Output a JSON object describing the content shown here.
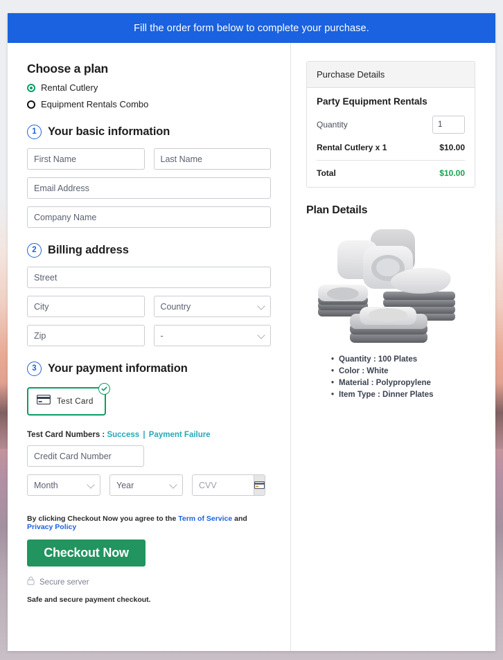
{
  "banner": {
    "message": "Fill the order form below to complete your purchase."
  },
  "plan": {
    "heading": "Choose a plan",
    "options": [
      {
        "label": "Rental Cutlery",
        "selected": true
      },
      {
        "label": "Equipment Rentals Combo",
        "selected": false
      }
    ]
  },
  "steps": {
    "basic": {
      "number": "1",
      "title": "Your basic information",
      "fields": {
        "first_name": "First Name",
        "last_name": "Last Name",
        "email": "Email Address",
        "company": "Company Name"
      }
    },
    "billing": {
      "number": "2",
      "title": "Billing address",
      "fields": {
        "street": "Street",
        "city": "City",
        "country": "Country",
        "zip": "Zip",
        "state": "-"
      }
    },
    "payment": {
      "number": "3",
      "title": "Your payment information",
      "method_label": "Test Card",
      "method_selected": true,
      "test_cards_prefix": "Test Card Numbers :",
      "test_card_success": "Success",
      "test_card_separator": "|",
      "test_card_failure": "Payment Failure",
      "fields": {
        "card_number": "Credit Card Number",
        "month": "Month",
        "year": "Year",
        "cvv": "CVV"
      }
    }
  },
  "footer": {
    "terms_prefix": "By clicking Checkout Now you agree to the",
    "terms_link": "Term of Service",
    "terms_and": "and",
    "privacy_link": "Privacy Policy",
    "checkout_label": "Checkout Now",
    "secure_server": "Secure server",
    "safe_note": "Safe and secure payment checkout."
  },
  "purchase": {
    "header": "Purchase Details",
    "product": "Party Equipment Rentals",
    "quantity_label": "Quantity",
    "quantity_value": "1",
    "line_item_label": "Rental Cutlery x 1",
    "line_item_amount": "$10.00",
    "total_label": "Total",
    "total_amount": "$10.00"
  },
  "plan_details": {
    "title": "Plan Details",
    "image_alt": "white square dinner plates and bowls stack",
    "specs": [
      "Quantity : 100 Plates",
      "Color : White",
      "Material : Polypropylene",
      "Item Type : Dinner Plates"
    ]
  },
  "colors": {
    "banner_blue": "#1a62df",
    "accent_green": "#0a9d62",
    "checkout_green": "#21945f",
    "total_green": "#16a34a",
    "link_teal": "#25a8b8",
    "link_blue": "#1a62df"
  }
}
